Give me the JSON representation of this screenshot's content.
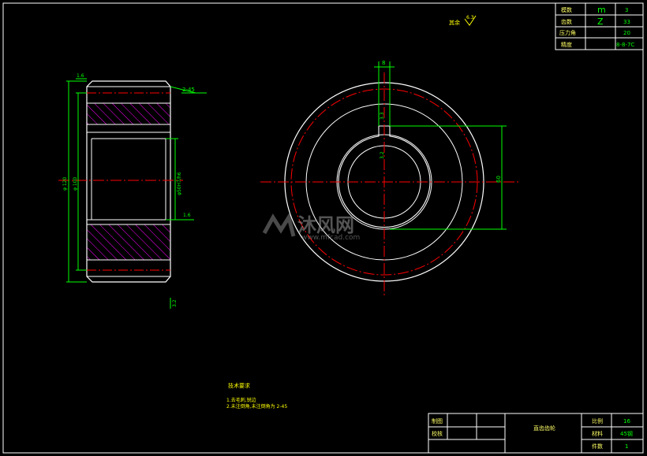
{
  "params_table": {
    "rows": [
      {
        "label": "模数",
        "symbol": "m",
        "value": "3"
      },
      {
        "label": "齿数",
        "symbol": "Z",
        "value": "33"
      },
      {
        "label": "压力角",
        "symbol": "",
        "value": "20"
      },
      {
        "label": "精度",
        "symbol": "",
        "value": "8-8-7C"
      }
    ]
  },
  "roughness_note": {
    "label": "其余",
    "value": "6.3"
  },
  "side_view": {
    "dims": {
      "top_roughness": "1.6",
      "chamfer": "2-45",
      "outer_dia": "φ 120",
      "inner_dia": "φ 100",
      "bore": "φ50H7/h6",
      "bore_roughness": "1.6",
      "bottom_roughness": "3.2"
    }
  },
  "front_view": {
    "dims": {
      "key_width": "8",
      "key_depth": "3.3",
      "key_roughness": "3.2",
      "dim_60": "60"
    }
  },
  "technical_requirements": {
    "title": "技术要求",
    "items": [
      "1.去毛刺,锐边",
      "2.未注倒角,未注倒角为 2-45"
    ]
  },
  "watermark": {
    "text": "沐风网",
    "url": "www.mfcad.com"
  },
  "title_block": {
    "part_name": "直齿齿轮",
    "drawn_label": "制图",
    "checked_label": "校核",
    "scale_label": "比例",
    "scale_value": "16",
    "material_label": "材料",
    "material_value": "45钢",
    "qty_label": "件数",
    "qty_value": "1"
  },
  "colors": {
    "line": "#ffffff",
    "dimension": "#00ff00",
    "centerline": "#ff0000",
    "hatch": "#ff00ff"
  }
}
